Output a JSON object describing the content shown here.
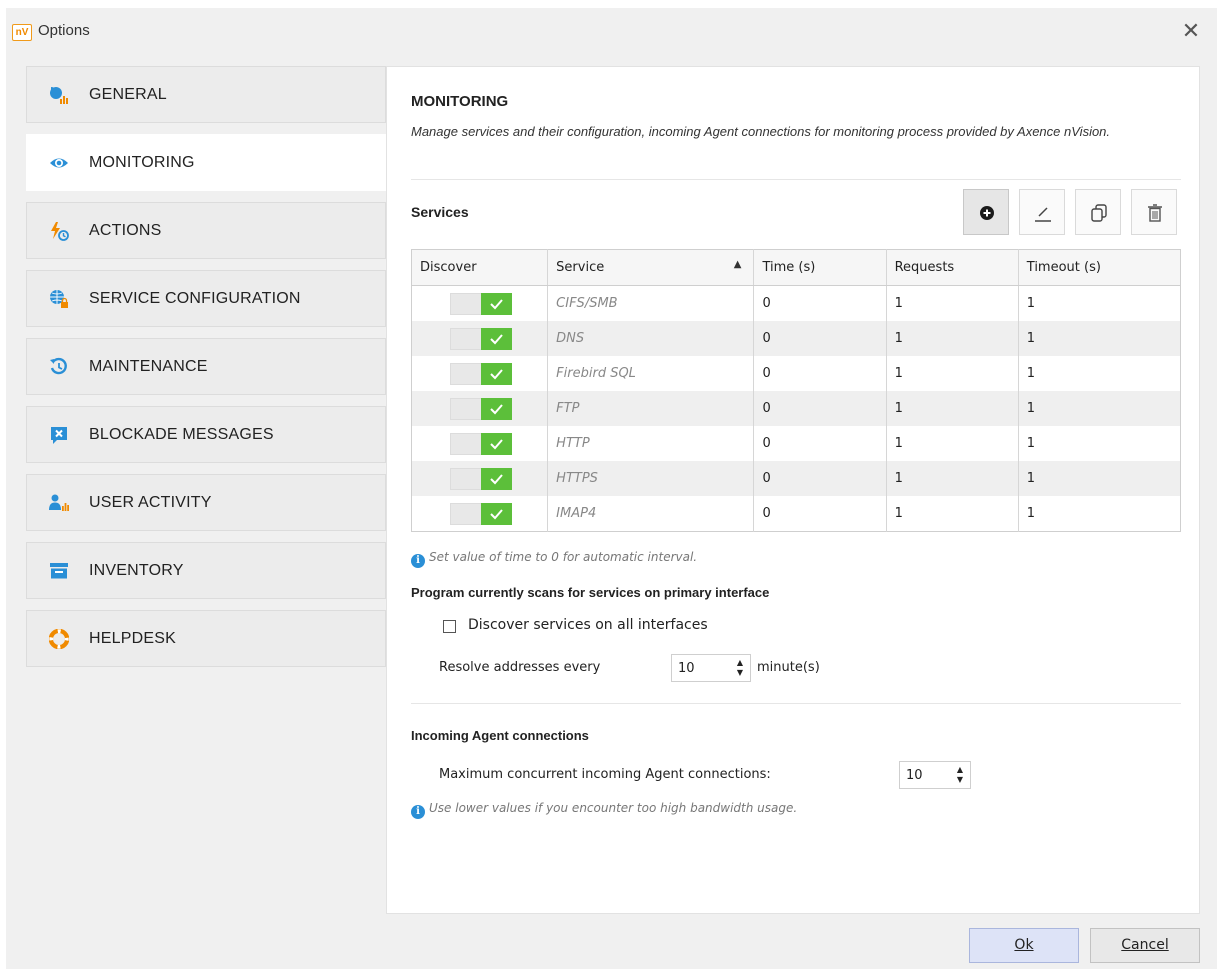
{
  "window": {
    "app_icon_text": "nV",
    "title": "Options"
  },
  "sidebar": {
    "items": [
      {
        "label": "GENERAL",
        "icon": "chart-icon"
      },
      {
        "label": "MONITORING",
        "icon": "eye-icon",
        "active": true
      },
      {
        "label": "ACTIONS",
        "icon": "lightning-clock-icon"
      },
      {
        "label": "SERVICE CONFIGURATION",
        "icon": "globe-lock-icon"
      },
      {
        "label": "MAINTENANCE",
        "icon": "history-icon"
      },
      {
        "label": "BLOCKADE MESSAGES",
        "icon": "message-block-icon"
      },
      {
        "label": "USER ACTIVITY",
        "icon": "user-activity-icon"
      },
      {
        "label": "INVENTORY",
        "icon": "inventory-icon"
      },
      {
        "label": "HELPDESK",
        "icon": "lifebuoy-icon"
      }
    ]
  },
  "panel": {
    "title": "MONITORING",
    "description": "Manage services and their configuration, incoming Agent connections for monitoring process provided by Axence nVision.",
    "services_label": "Services",
    "toolbar": [
      "add-icon",
      "edit-icon",
      "copy-icon",
      "delete-icon"
    ],
    "table": {
      "columns": [
        "Discover",
        "Service",
        "Time (s)",
        "Requests",
        "Timeout (s)"
      ],
      "sort_column": "Service",
      "rows": [
        {
          "discover": true,
          "service": "CIFS/SMB",
          "time": "0",
          "requests": "1",
          "timeout": "1"
        },
        {
          "discover": true,
          "service": "DNS",
          "time": "0",
          "requests": "1",
          "timeout": "1"
        },
        {
          "discover": true,
          "service": "Firebird SQL",
          "time": "0",
          "requests": "1",
          "timeout": "1"
        },
        {
          "discover": true,
          "service": "FTP",
          "time": "0",
          "requests": "1",
          "timeout": "1"
        },
        {
          "discover": true,
          "service": "HTTP",
          "time": "0",
          "requests": "1",
          "timeout": "1"
        },
        {
          "discover": true,
          "service": "HTTPS",
          "time": "0",
          "requests": "1",
          "timeout": "1"
        },
        {
          "discover": true,
          "service": "IMAP4",
          "time": "0",
          "requests": "1",
          "timeout": "1"
        }
      ]
    },
    "time_hint": "Set value of time to 0 for automatic interval.",
    "scan_heading": "Program currently scans for services on primary interface",
    "discover_all_label": "Discover services on all interfaces",
    "discover_all_checked": false,
    "resolve_label": "Resolve addresses every",
    "resolve_value": "10",
    "resolve_unit": "minute(s)",
    "agent_heading": "Incoming Agent connections",
    "max_agent_label": "Maximum concurrent incoming Agent connections:",
    "max_agent_value": "10",
    "bandwidth_hint": "Use lower values if you encounter too high bandwidth usage."
  },
  "footer": {
    "ok_label": "Ok",
    "cancel_label": "Cancel"
  },
  "colors": {
    "accent_green": "#5cbf3a",
    "icon_blue": "#2a8fd6",
    "ok_button": "#dde3f7"
  }
}
